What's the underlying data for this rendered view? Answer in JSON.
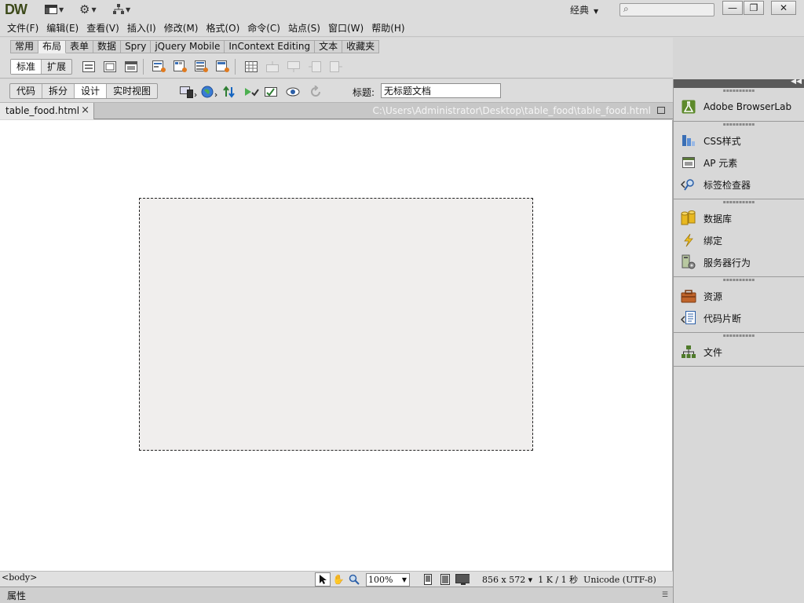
{
  "app": {
    "logo": "DW"
  },
  "titlebar": {
    "workspace_label": "经典",
    "search_placeholder": ""
  },
  "menu": {
    "items": [
      "文件(F)",
      "编辑(E)",
      "查看(V)",
      "插入(I)",
      "修改(M)",
      "格式(O)",
      "命令(C)",
      "站点(S)",
      "窗口(W)",
      "帮助(H)"
    ]
  },
  "insert_panel": {
    "tabs": [
      "常用",
      "布局",
      "表单",
      "数据",
      "Spry",
      "jQuery Mobile",
      "InContext Editing",
      "文本",
      "收藏夹"
    ],
    "active_tab": "布局",
    "mode_buttons": [
      "标准",
      "扩展"
    ],
    "active_mode": "标准"
  },
  "doc_toolbar": {
    "views": [
      "代码",
      "拆分",
      "设计",
      "实时视图"
    ],
    "active_view": "设计",
    "title_label": "标题:",
    "title_value": "无标题文档"
  },
  "document": {
    "tab_name": "table_food.html",
    "close_glyph": "×",
    "path": "C:\\Users\\Administrator\\Desktop\\table_food\\table_food.html"
  },
  "status": {
    "tag": "<body>",
    "zoom": "100%",
    "info": "856 x 572 ▾  1 K / 1 秒  Unicode (UTF-8)"
  },
  "properties": {
    "label": "属性"
  },
  "dock": {
    "groups": [
      {
        "items": [
          {
            "label": "Adobe BrowserLab",
            "icon": "browserlab-icon"
          }
        ]
      },
      {
        "items": [
          {
            "label": "CSS样式",
            "icon": "css-styles-icon"
          },
          {
            "label": "AP 元素",
            "icon": "ap-elements-icon"
          },
          {
            "label": "标签检查器",
            "icon": "tag-inspector-icon"
          }
        ]
      },
      {
        "items": [
          {
            "label": "数据库",
            "icon": "database-icon"
          },
          {
            "label": "绑定",
            "icon": "bindings-icon"
          },
          {
            "label": "服务器行为",
            "icon": "server-behaviors-icon"
          }
        ]
      },
      {
        "items": [
          {
            "label": "资源",
            "icon": "assets-icon"
          },
          {
            "label": "代码片断",
            "icon": "snippets-icon"
          }
        ]
      },
      {
        "items": [
          {
            "label": "文件",
            "icon": "files-icon"
          }
        ]
      }
    ]
  },
  "colors": {
    "chrome": "#dcdcdc",
    "canvas": "#ffffff",
    "ap_div_fill": "#f0eeed",
    "dock_header": "#5a5a5a"
  }
}
